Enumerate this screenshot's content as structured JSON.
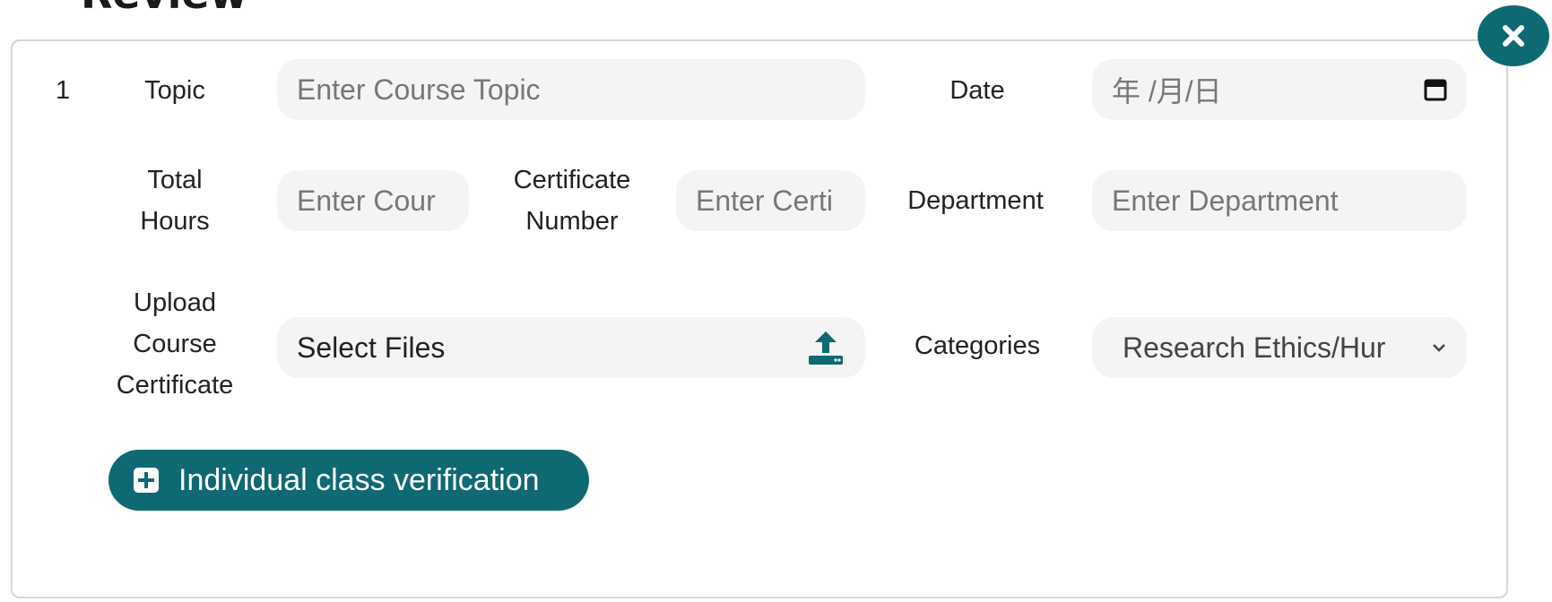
{
  "section": {
    "title": "Review"
  },
  "row": {
    "index": "1",
    "topic": {
      "label": "Topic",
      "placeholder": "Enter Course Topic"
    },
    "date": {
      "label": "Date",
      "value": "年 /月/日"
    },
    "total_hours": {
      "label_line1": "Total",
      "label_line2": "Hours",
      "placeholder": "Enter Cour"
    },
    "certificate_number": {
      "label_line1": "Certificate",
      "label_line2": "Number",
      "placeholder": "Enter Certi"
    },
    "department": {
      "label": "Department",
      "placeholder": "Enter Department"
    },
    "upload": {
      "label_line1": "Upload",
      "label_line2": "Course",
      "label_line3": "Certificate",
      "button_text": "Select Files"
    },
    "categories": {
      "label": "Categories",
      "selected": "Research Ethics/Hur"
    }
  },
  "actions": {
    "add_verification": "Individual class verification"
  },
  "colors": {
    "accent": "#0f6973",
    "field_bg": "#f4f4f4",
    "border": "#d6d6d6"
  },
  "icons": [
    "close-icon",
    "calendar-icon",
    "upload-icon",
    "chevron-down-icon",
    "plus-square-icon"
  ]
}
